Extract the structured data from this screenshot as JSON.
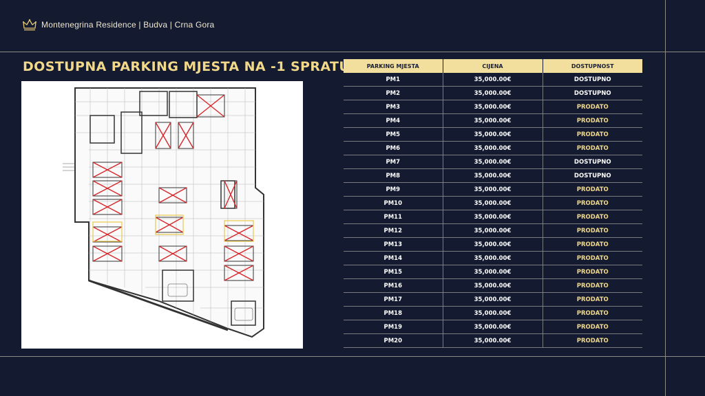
{
  "brand": {
    "name": "Montenegrina Residence | Budva | Crna Gora",
    "icon": "crown-icon"
  },
  "title": "DOSTUPNA PARKING MJESTA NA -1 SPRATU",
  "colors": {
    "background": "#141a30",
    "accent_gold": "#f2d98a",
    "header_fill": "#f2df9e"
  },
  "table": {
    "headers": [
      "PARKING MJESTA",
      "CIJENA",
      "DOSTUPNOST"
    ],
    "rows": [
      [
        "PM1",
        "35,000.00€",
        "DOSTUPNO"
      ],
      [
        "PM2",
        "35,000.00€",
        "DOSTUPNO"
      ],
      [
        "PM3",
        "35,000.00€",
        "PRODATO"
      ],
      [
        "PM4",
        "35,000.00€",
        "PRODATO"
      ],
      [
        "PM5",
        "35,000.00€",
        "PRODATO"
      ],
      [
        "PM6",
        "35,000.00€",
        "PRODATO"
      ],
      [
        "PM7",
        "35,000.00€",
        "DOSTUPNO"
      ],
      [
        "PM8",
        "35,000.00€",
        "DOSTUPNO"
      ],
      [
        "PM9",
        "35,000.00€",
        "PRODATO"
      ],
      [
        "PM10",
        "35,000.00€",
        "PRODATO"
      ],
      [
        "PM11",
        "35,000.00€",
        "PRODATO"
      ],
      [
        "PM12",
        "35,000.00€",
        "PRODATO"
      ],
      [
        "PM13",
        "35,000.00€",
        "PRODATO"
      ],
      [
        "PM14",
        "35,000.00€",
        "PRODATO"
      ],
      [
        "PM15",
        "35,000.00€",
        "PRODATO"
      ],
      [
        "PM16",
        "35,000.00€",
        "PRODATO"
      ],
      [
        "PM17",
        "35,000.00€",
        "PRODATO"
      ],
      [
        "PM18",
        "35,000.00€",
        "PRODATO"
      ],
      [
        "PM19",
        "35,000.00€",
        "PRODATO"
      ],
      [
        "PM20",
        "35,000.00€",
        "PRODATO"
      ]
    ]
  }
}
